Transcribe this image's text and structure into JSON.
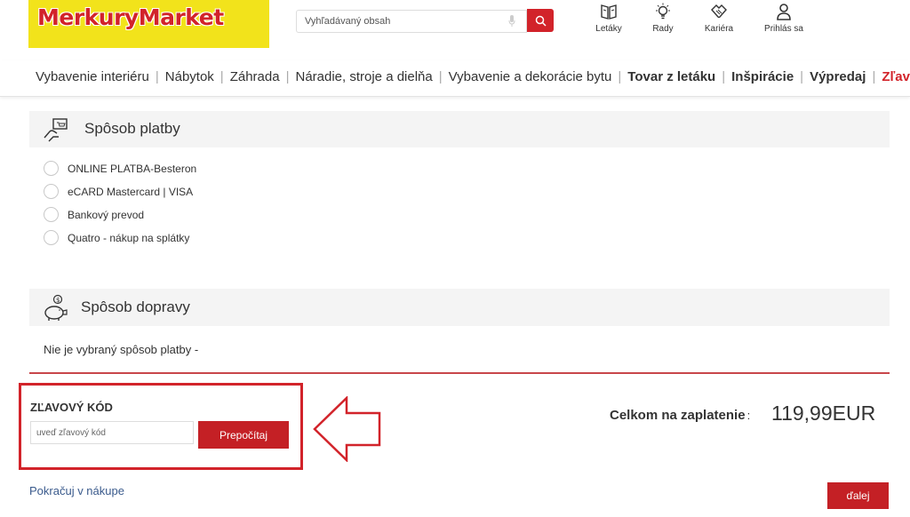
{
  "brand": {
    "name": "MerkuryMarket",
    "accent": "#d2232a",
    "logo_bg": "#f2e31b"
  },
  "search": {
    "placeholder": "Vyhľadávaný obsah",
    "mic_icon": "microphone-icon",
    "button_icon": "search-icon"
  },
  "header_links": [
    {
      "label": "Letáky",
      "icon": "book-icon"
    },
    {
      "label": "Rady",
      "icon": "lightbulb-icon"
    },
    {
      "label": "Kariéra",
      "icon": "handshake-icon"
    },
    {
      "label": "Prihlás sa",
      "icon": "user-icon"
    }
  ],
  "nav": [
    {
      "label": "Vybavenie interiéru",
      "style": "normal"
    },
    {
      "label": "Nábytok",
      "style": "normal"
    },
    {
      "label": "Záhrada",
      "style": "normal"
    },
    {
      "label": "Náradie, stroje a dielňa",
      "style": "normal"
    },
    {
      "label": "Vybavenie a dekorácie bytu",
      "style": "normal"
    },
    {
      "label": "Tovar z letáku",
      "style": "bold"
    },
    {
      "label": "Inšpirácie",
      "style": "bold"
    },
    {
      "label": "Výpredaj",
      "style": "bold"
    },
    {
      "label": "Zľavy",
      "style": "red"
    }
  ],
  "payment": {
    "title": "Spôsob platby",
    "icon": "payment-hand-icon",
    "options": [
      "ONLINE PLATBA-Besteron",
      "eCARD Mastercard | VISA",
      "Bankový prevod",
      "Quatro - nákup na splátky"
    ]
  },
  "shipping": {
    "title": "Spôsob dopravy",
    "icon": "piggy-bank-icon",
    "note": "Nie je vybraný spôsob platby -"
  },
  "discount": {
    "title": "ZĽAVOVÝ KÓD",
    "placeholder": "uveď zľavový kód",
    "button": "Prepočítaj",
    "highlight_color": "#d2232a",
    "annotation_icon": "arrow-left-icon"
  },
  "total": {
    "label": "Celkom na zaplatenie",
    "colon": ":",
    "value": "119,99EUR"
  },
  "footer": {
    "continue": "Pokračuj v nákupe",
    "next": "ďalej"
  }
}
